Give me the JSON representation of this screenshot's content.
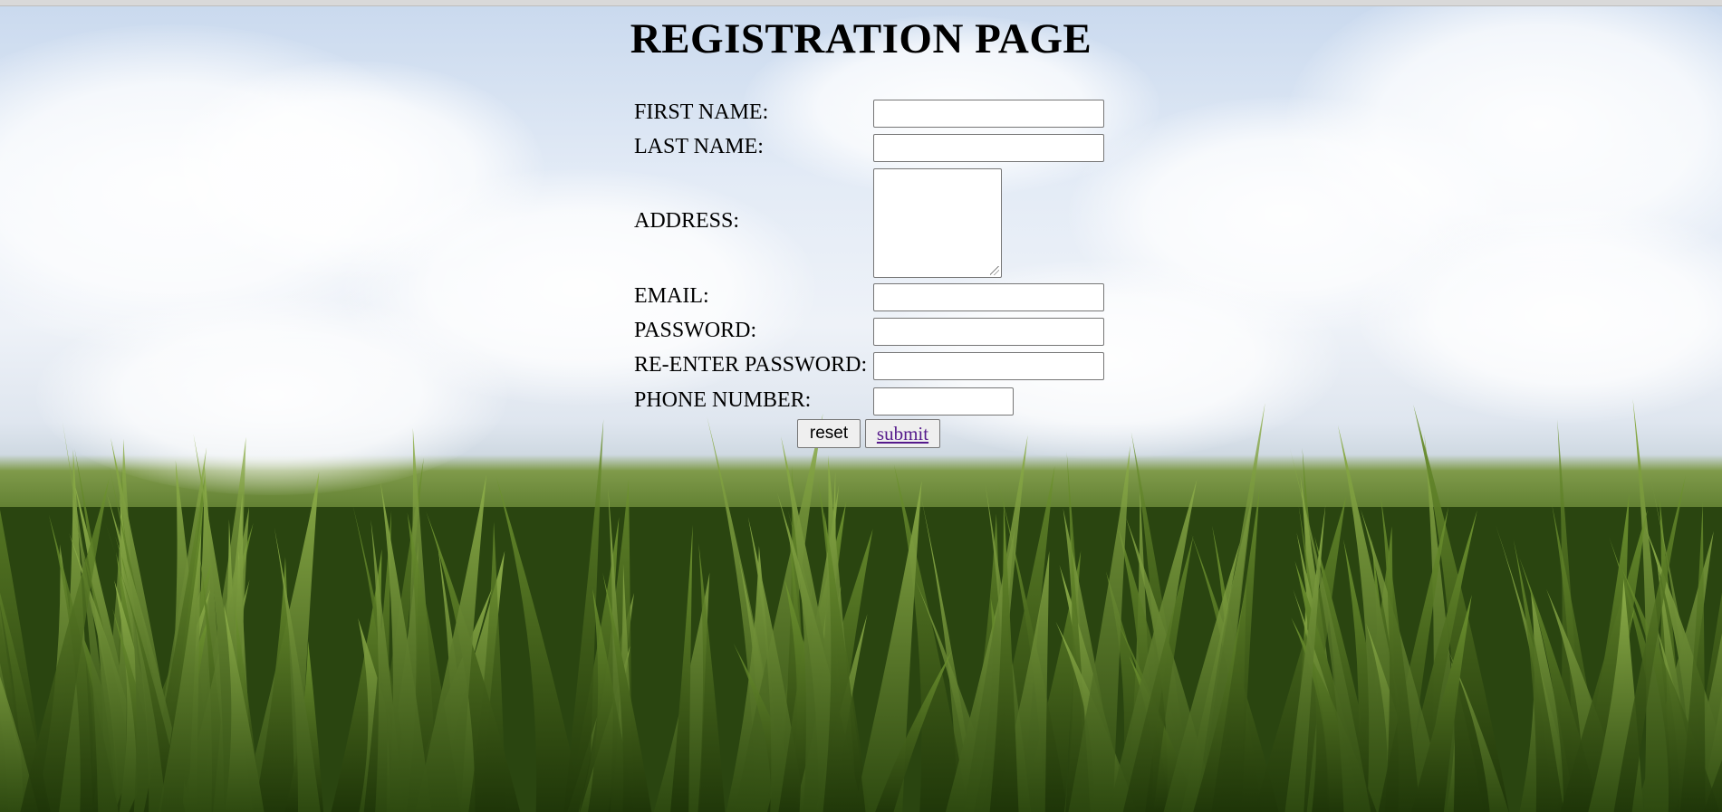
{
  "page": {
    "title": "REGISTRATION PAGE"
  },
  "form": {
    "first_name_label": "FIRST NAME:",
    "first_name_value": "",
    "last_name_label": "LAST NAME:",
    "last_name_value": "",
    "address_label": "ADDRESS:",
    "address_value": "",
    "email_label": "EMAIL:",
    "email_value": "",
    "password_label": "PASSWORD:",
    "password_value": "",
    "reenter_password_label": "RE-ENTER PASSWORD:",
    "reenter_password_value": "",
    "phone_label": "PHONE NUMBER:",
    "phone_value": ""
  },
  "buttons": {
    "reset_label": "reset",
    "submit_label": "submit"
  },
  "colors": {
    "link_visited": "#551a8b",
    "field_border": "#767676",
    "button_bg": "#efefef"
  }
}
